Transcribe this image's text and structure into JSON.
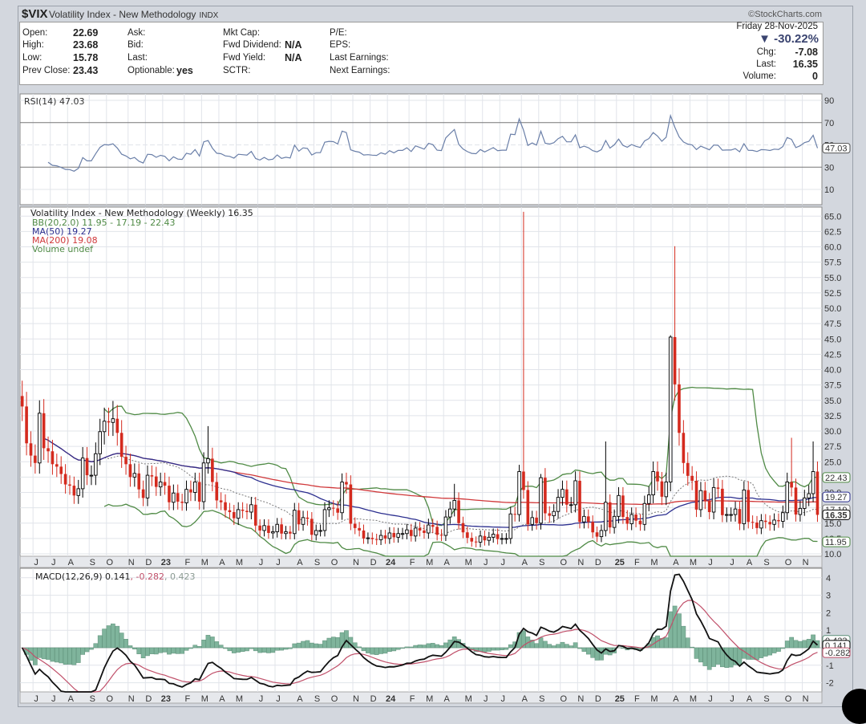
{
  "header": {
    "symbol": "$VIX",
    "name": "Volatility Index - New Methodology",
    "exchange": "INDX",
    "copyright": "©StockCharts.com",
    "date": "Friday  28-Nov-2025",
    "change_pct": "▼ -30.22%",
    "chg_label": "Chg:",
    "chg_value": "-7.08",
    "last_label": "Last:",
    "last_value": "16.35",
    "volume_label": "Volume:",
    "volume_value": "0"
  },
  "quote": {
    "open_label": "Open:",
    "open": "22.69",
    "high_label": "High:",
    "high": "23.68",
    "low_label": "Low:",
    "low": "15.78",
    "prev_close_label": "Prev Close:",
    "prev_close": "23.43",
    "ask_label": "Ask:",
    "bid_label": "Bid:",
    "last_label": "Last:",
    "optionable_label": "Optionable:",
    "optionable": "yes",
    "mkt_cap_label": "Mkt Cap:",
    "fwd_dividend_label": "Fwd Dividend:",
    "fwd_dividend": "N/A",
    "fwd_yield_label": "Fwd Yield:",
    "fwd_yield": "N/A",
    "sctr_label": "SCTR:",
    "pe_label": "P/E:",
    "eps_label": "EPS:",
    "last_earnings_label": "Last Earnings:",
    "next_earnings_label": "Next Earnings:"
  },
  "colors": {
    "up": "#000000",
    "down": "#d42a1e",
    "bb": "#4f8a45",
    "ma50": "#2c2f8f",
    "ma200": "#d0383a",
    "macd": "#111111",
    "signal": "#c0506a",
    "hist": "#7fb49c",
    "rsi": "#6a7fa8"
  },
  "chart_data": {
    "type": "candlestick",
    "title": "Volatility Index - New Methodology (Weekly) 16.35",
    "period": "weekly",
    "legend": {
      "price": "Volatility Index - New Methodology (Weekly) 16.35",
      "bb": "BB(20,2.0) 11.95 - 17.19 - 22.43",
      "ma50": "MA(50) 19.27",
      "ma200": "MA(200) 19.08",
      "volume": "Volume undef",
      "rsi": "RSI(14) 47.03",
      "macd_prefix": "MACD(12,26,9) 0.141",
      "macd_signal": ", -0.282",
      "macd_hist": ", 0.423"
    },
    "closes": [
      34,
      28,
      26,
      24.8,
      32.9,
      27.2,
      26.7,
      24.6,
      24.2,
      23.0,
      21.3,
      21.1,
      19.5,
      20.6,
      25.6,
      22.8,
      22.8,
      26.3,
      29.9,
      31.6,
      31.4,
      32.0,
      29.7,
      25.8,
      24.6,
      22.5,
      23.1,
      20.5,
      19.1,
      22.8,
      22.6,
      20.9,
      21.7,
      21.1,
      18.4,
      19.9,
      18.5,
      18.3,
      20.5,
      20.0,
      21.7,
      18.5,
      24.8,
      25.5,
      21.7,
      18.7,
      18.4,
      17.1,
      16.8,
      15.8,
      17.2,
      17.0,
      16.8,
      18.0,
      14.6,
      13.8,
      14.6,
      13.4,
      13.6,
      14.8,
      13.3,
      13.6,
      13.3,
      17.1,
      14.8,
      15.9,
      15.7,
      13.1,
      13.8,
      13.8,
      17.2,
      17.5,
      17.4,
      16.7,
      21.7,
      21.3,
      14.9,
      14.2,
      13.8,
      12.5,
      12.6,
      12.4,
      12.3,
      13.0,
      12.5,
      13.4,
      12.7,
      13.3,
      13.3,
      13.9,
      12.9,
      14.2,
      13.8,
      13.4,
      14.7,
      14.4,
      13.1,
      13.0,
      16.0,
      17.3,
      18.7,
      15.0,
      13.5,
      12.6,
      12.0,
      11.9,
      12.9,
      12.2,
      12.7,
      13.2,
      12.4,
      12.5,
      12.5,
      16.5,
      16.4,
      23.4,
      20.4,
      14.8,
      15.9,
      15.0,
      22.4,
      16.6,
      16.2,
      16.9,
      19.2,
      20.5,
      18.0,
      18.0,
      21.9,
      15.2,
      16.1,
      15.2,
      13.5,
      12.8,
      13.8,
      18.4,
      14.3,
      16.1,
      19.5,
      16.0,
      14.9,
      16.4,
      15.4,
      14.8,
      18.2,
      19.6,
      23.4,
      21.8,
      19.3,
      21.7,
      45.3,
      37.6,
      29.7,
      24.8,
      22.7,
      21.9,
      17.2,
      20.3,
      18.6,
      16.8,
      20.8,
      20.6,
      16.3,
      16.4,
      16.4,
      17.3,
      14.9,
      20.4,
      15.2,
      15.1,
      14.2,
      15.4,
      15.2,
      14.8,
      15.5,
      15.3,
      16.7,
      21.7,
      20.8,
      16.4,
      17.4,
      19.1,
      19.8,
      23.4,
      16.35
    ],
    "notable_highs": [
      [
        4,
        35.0
      ],
      [
        21,
        34.9
      ],
      [
        43,
        30.8
      ],
      [
        74,
        23.1
      ],
      [
        100,
        21.4
      ],
      [
        115,
        24.5
      ],
      [
        116,
        65.7
      ],
      [
        120,
        23.0
      ],
      [
        135,
        28.3
      ],
      [
        150,
        45.6
      ],
      [
        151,
        60.1
      ],
      [
        178,
        28.9
      ],
      [
        183,
        28.3
      ]
    ],
    "x_labels": [
      [
        "J",
        3
      ],
      [
        "J",
        7
      ],
      [
        "A",
        11
      ],
      [
        "S",
        16
      ],
      [
        "O",
        20
      ],
      [
        "N",
        25
      ],
      [
        "D",
        29
      ],
      [
        "23",
        33
      ],
      [
        "F",
        38
      ],
      [
        "M",
        42
      ],
      [
        "A",
        46
      ],
      [
        "M",
        50
      ],
      [
        "J",
        55
      ],
      [
        "J",
        59
      ],
      [
        "A",
        64
      ],
      [
        "S",
        68
      ],
      [
        "O",
        72
      ],
      [
        "N",
        77
      ],
      [
        "D",
        81
      ],
      [
        "24",
        85
      ],
      [
        "F",
        90
      ],
      [
        "M",
        94
      ],
      [
        "A",
        98
      ],
      [
        "M",
        103
      ],
      [
        "J",
        107
      ],
      [
        "J",
        111
      ],
      [
        "A",
        116
      ],
      [
        "S",
        120
      ],
      [
        "O",
        125
      ],
      [
        "N",
        129
      ],
      [
        "D",
        133
      ],
      [
        "25",
        138
      ],
      [
        "F",
        142
      ],
      [
        "M",
        146
      ],
      [
        "A",
        151
      ],
      [
        "M",
        155
      ],
      [
        "J",
        159
      ],
      [
        "J",
        164
      ],
      [
        "A",
        168
      ],
      [
        "S",
        172
      ],
      [
        "O",
        177
      ],
      [
        "N",
        181
      ]
    ],
    "price_axis": {
      "min": 10,
      "max": 66,
      "ticks": [
        "10.0",
        "12.5",
        "15.0",
        "17.5",
        "20.0",
        "22.5",
        "25.0",
        "27.5",
        "30.0",
        "32.5",
        "35.0",
        "37.5",
        "40.0",
        "42.5",
        "45.0",
        "47.5",
        "50.0",
        "52.5",
        "55.0",
        "57.5",
        "60.0",
        "62.5",
        "65.0"
      ]
    },
    "price_tags": [
      [
        "22.43",
        22.43,
        "bb"
      ],
      [
        "19.27",
        19.27,
        "ma50"
      ],
      [
        "17.19",
        17.19,
        "mid"
      ],
      [
        "16.35",
        16.35,
        "last"
      ],
      [
        "11.95",
        11.95,
        "bb"
      ]
    ],
    "rsi_axis": {
      "ticks": [
        "10",
        "30",
        "50",
        "70",
        "90"
      ],
      "tag": "47.03",
      "tag_value": 47.03
    },
    "macd_axis": {
      "ticks": [
        "-2",
        "-1",
        "1",
        "2",
        "3",
        "4"
      ],
      "tags": [
        [
          "0.423",
          0.423,
          "hist"
        ],
        [
          "0.141",
          0.141,
          "macd"
        ],
        [
          "-0.282",
          -0.282,
          "signal"
        ]
      ]
    }
  }
}
